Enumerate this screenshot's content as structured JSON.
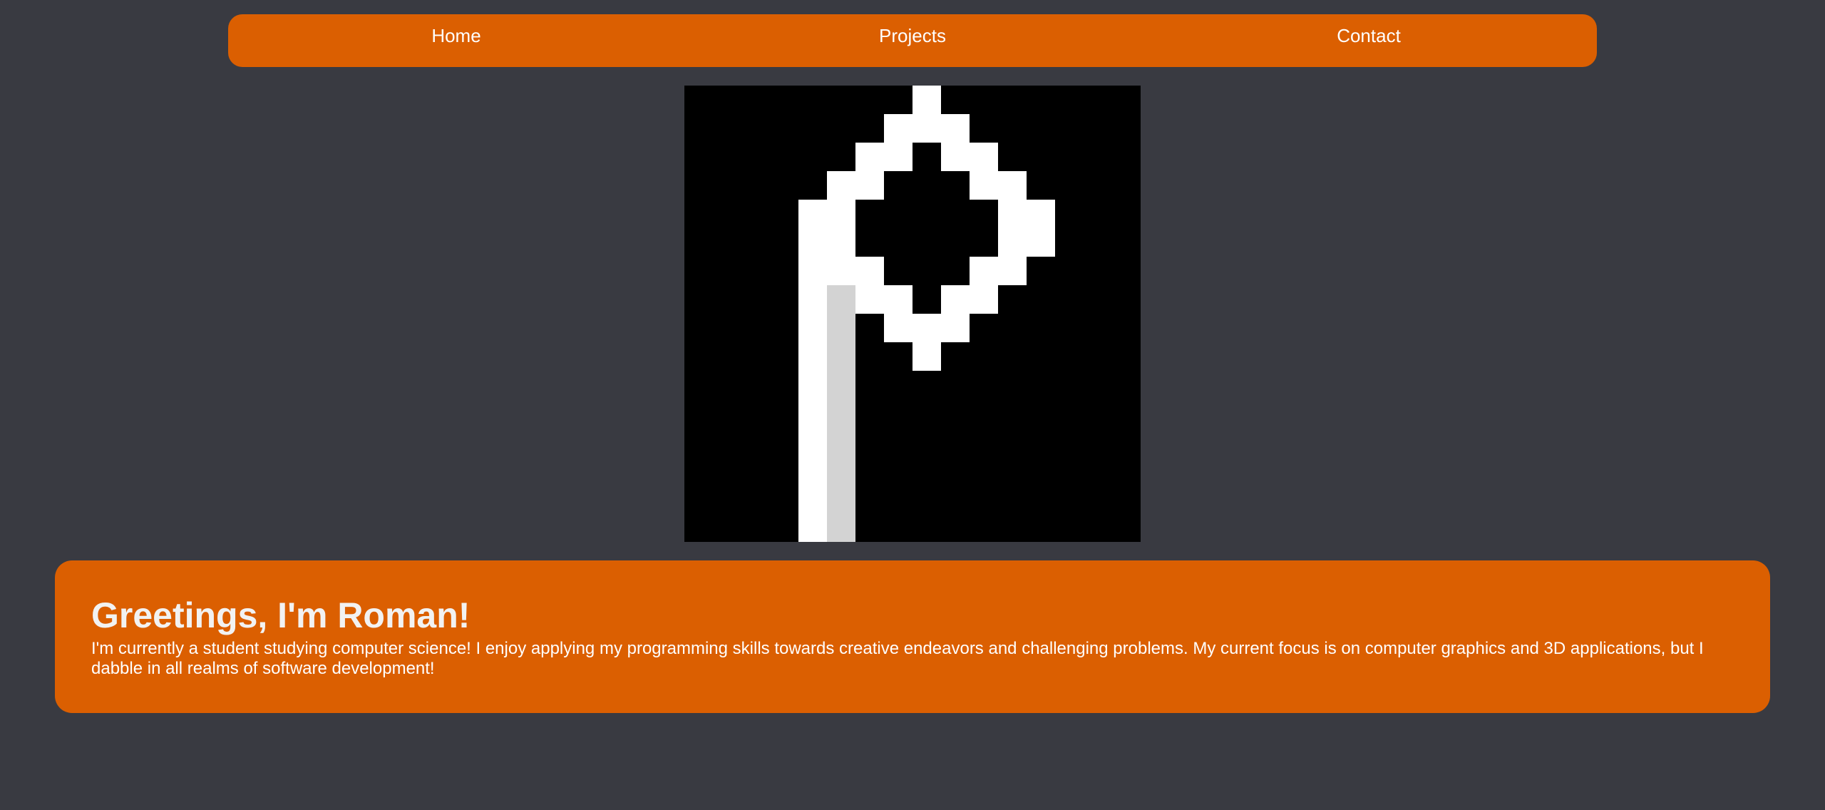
{
  "nav": {
    "items": [
      {
        "label": "Home"
      },
      {
        "label": "Projects"
      },
      {
        "label": "Contact"
      }
    ]
  },
  "logo": {
    "icon": "pixel-letter-p-logo",
    "colors": {
      "background": "#000000",
      "primary": "#ffffff",
      "shade": "#d3d3d3"
    }
  },
  "intro": {
    "heading": "Greetings, I'm Roman!",
    "body": "I'm currently a student studying computer science! I enjoy applying my programming skills towards creative endeavors and challenging problems. My current focus is on computer graphics and 3D applications, but I dabble in all realms of software development!"
  },
  "colors": {
    "page_background": "#393a41",
    "accent": "#db5f01",
    "text": "#ffffff"
  }
}
